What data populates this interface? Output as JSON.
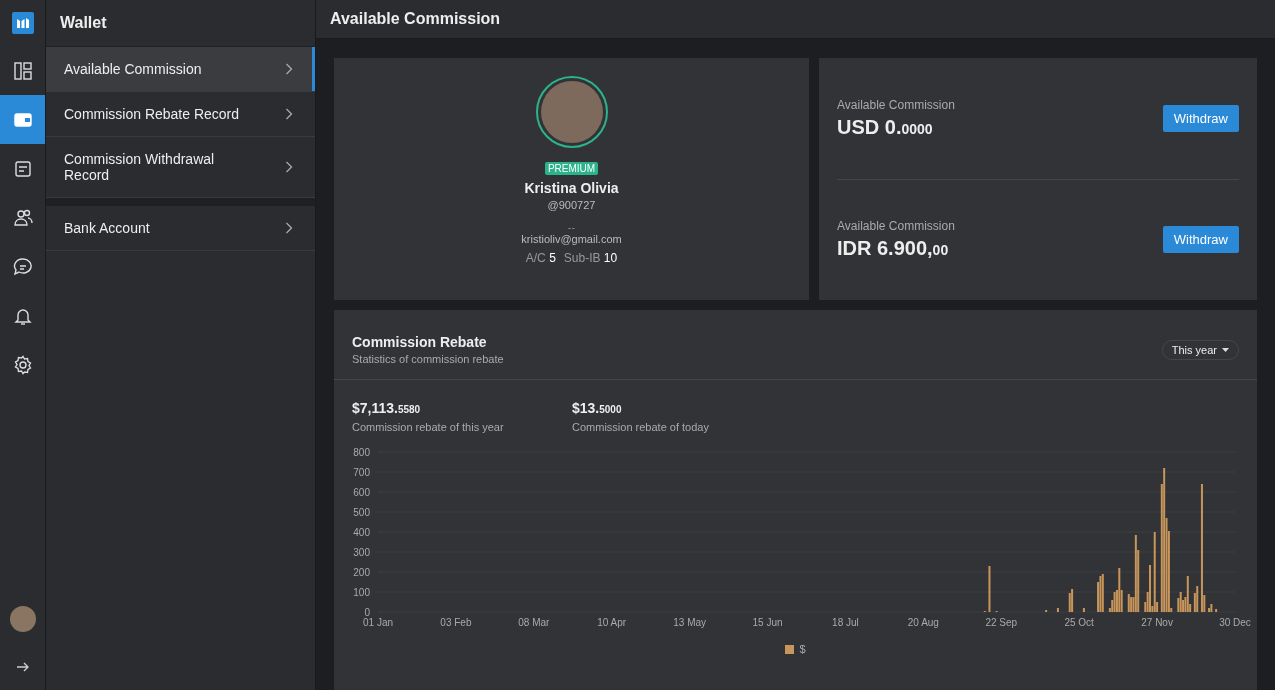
{
  "rail": [
    {
      "kind": "dashboard",
      "selected": false
    },
    {
      "kind": "wallet",
      "selected": true
    },
    {
      "kind": "document",
      "selected": false
    },
    {
      "kind": "users",
      "selected": false
    },
    {
      "kind": "chat",
      "selected": false
    },
    {
      "kind": "bell",
      "selected": false
    },
    {
      "kind": "settings",
      "selected": false
    }
  ],
  "sidebar": {
    "title": "Wallet",
    "groups": [
      {
        "items": [
          {
            "label": "Available Commission",
            "selected": true
          },
          {
            "label": "Commission Rebate Record",
            "selected": false
          },
          {
            "label": "Commission Withdrawal Record",
            "selected": false
          }
        ]
      },
      {
        "items": [
          {
            "label": "Bank Account",
            "selected": false
          }
        ]
      }
    ]
  },
  "page_title": "Available Commission",
  "profile": {
    "badge": "PREMIUM",
    "name": "Kristina Olivia",
    "handle": "@900727",
    "phone": "--",
    "email": "kristioliv@gmail.com",
    "stats": [
      {
        "label": "A/C",
        "value": "5"
      },
      {
        "label": "Sub-IB",
        "value": "10"
      }
    ]
  },
  "balances": [
    {
      "label": "Available Commission",
      "amount_main": "USD 0.",
      "amount_fraction": "0000",
      "button": "Withdraw"
    },
    {
      "label": "Available Commission",
      "amount_main": "IDR 6.900,",
      "amount_fraction": "00",
      "button": "Withdraw"
    }
  ],
  "rebate": {
    "title": "Commission Rebate",
    "subtitle": "Statistics of commission rebate",
    "period": "This year",
    "totals": [
      {
        "main": "$7,113.",
        "fraction": "5580",
        "label": "Commission rebate of this year"
      },
      {
        "main": "$13.",
        "fraction": "5000",
        "label": "Commission rebate of today"
      }
    ],
    "chart_data": {
      "type": "bar",
      "ylim": [
        0,
        800
      ],
      "yticks": [
        0,
        100,
        200,
        300,
        400,
        500,
        600,
        700,
        800
      ],
      "categories": [
        "01 Jan",
        null,
        null,
        null,
        null,
        null,
        null,
        null,
        null,
        null,
        null,
        null,
        null,
        null,
        null,
        null,
        null,
        null,
        null,
        null,
        null,
        null,
        null,
        null,
        null,
        null,
        null,
        null,
        null,
        null,
        null,
        null,
        null,
        "03 Feb",
        null,
        null,
        null,
        null,
        null,
        null,
        null,
        null,
        null,
        null,
        null,
        null,
        null,
        null,
        null,
        null,
        null,
        null,
        null,
        null,
        null,
        null,
        null,
        null,
        null,
        null,
        null,
        null,
        null,
        null,
        null,
        null,
        "08 Mar",
        null,
        null,
        null,
        null,
        null,
        null,
        null,
        null,
        null,
        null,
        null,
        null,
        null,
        null,
        null,
        null,
        null,
        null,
        null,
        null,
        null,
        null,
        null,
        null,
        null,
        null,
        null,
        null,
        null,
        null,
        null,
        null,
        "10 Apr",
        null,
        null,
        null,
        null,
        null,
        null,
        null,
        null,
        null,
        null,
        null,
        null,
        null,
        null,
        null,
        null,
        null,
        null,
        null,
        null,
        null,
        null,
        null,
        null,
        null,
        null,
        null,
        null,
        null,
        null,
        null,
        null,
        "13 May",
        null,
        null,
        null,
        null,
        null,
        null,
        null,
        null,
        null,
        null,
        null,
        null,
        null,
        null,
        null,
        null,
        null,
        null,
        null,
        null,
        null,
        null,
        null,
        null,
        null,
        null,
        null,
        null,
        null,
        null,
        null,
        null,
        "15 Jun",
        null,
        null,
        null,
        null,
        null,
        null,
        null,
        null,
        null,
        null,
        null,
        null,
        null,
        null,
        null,
        null,
        null,
        null,
        null,
        null,
        null,
        null,
        null,
        null,
        null,
        null,
        null,
        null,
        null,
        null,
        null,
        null,
        "18 Jul",
        null,
        null,
        null,
        null,
        null,
        null,
        null,
        null,
        null,
        null,
        null,
        null,
        null,
        null,
        null,
        null,
        null,
        null,
        null,
        null,
        null,
        null,
        null,
        null,
        null,
        null,
        null,
        null,
        null,
        null,
        null,
        null,
        "20 Aug",
        null,
        null,
        null,
        null,
        null,
        null,
        null,
        null,
        null,
        null,
        null,
        null,
        null,
        null,
        null,
        null,
        null,
        null,
        null,
        null,
        null,
        null,
        null,
        null,
        null,
        null,
        null,
        null,
        null,
        null,
        null,
        null,
        "22 Sep",
        null,
        null,
        null,
        null,
        null,
        null,
        null,
        null,
        null,
        null,
        null,
        null,
        null,
        null,
        null,
        null,
        null,
        null,
        null,
        null,
        null,
        null,
        null,
        null,
        null,
        null,
        null,
        null,
        null,
        null,
        null,
        null,
        "25 Oct",
        null,
        null,
        null,
        null,
        null,
        null,
        null,
        null,
        null,
        null,
        null,
        null,
        null,
        null,
        null,
        null,
        null,
        null,
        null,
        null,
        null,
        null,
        null,
        null,
        null,
        null,
        null,
        null,
        null,
        null,
        null,
        null,
        "27 Nov",
        null,
        null,
        null,
        null,
        null,
        null,
        null,
        null,
        null,
        null,
        null,
        null,
        null,
        null,
        null,
        null,
        null,
        null,
        null,
        null,
        null,
        null,
        null,
        null,
        null,
        null,
        null,
        null,
        null,
        null,
        null,
        null,
        "30 Dec"
      ],
      "series": [
        {
          "name": "$",
          "color": "#c8955a",
          "values": [
            0,
            0,
            0,
            0,
            0,
            0,
            0,
            0,
            0,
            0,
            0,
            0,
            0,
            0,
            0,
            0,
            0,
            0,
            0,
            0,
            0,
            0,
            0,
            0,
            0,
            0,
            0,
            0,
            0,
            0,
            0,
            0,
            0,
            0,
            0,
            0,
            0,
            0,
            0,
            0,
            0,
            0,
            0,
            0,
            0,
            0,
            0,
            0,
            0,
            0,
            0,
            0,
            0,
            0,
            0,
            0,
            0,
            0,
            0,
            0,
            0,
            0,
            0,
            0,
            0,
            0,
            0,
            0,
            0,
            0,
            0,
            0,
            0,
            0,
            0,
            0,
            0,
            0,
            0,
            0,
            0,
            0,
            0,
            0,
            0,
            0,
            0,
            0,
            0,
            0,
            0,
            0,
            0,
            0,
            0,
            0,
            0,
            0,
            0,
            0,
            0,
            0,
            0,
            0,
            0,
            0,
            0,
            0,
            0,
            0,
            0,
            0,
            0,
            0,
            0,
            0,
            0,
            0,
            0,
            0,
            0,
            0,
            0,
            0,
            0,
            0,
            0,
            0,
            0,
            0,
            0,
            0,
            0,
            0,
            0,
            0,
            0,
            0,
            0,
            0,
            0,
            0,
            0,
            0,
            0,
            0,
            0,
            0,
            0,
            0,
            0,
            0,
            0,
            0,
            0,
            0,
            0,
            0,
            0,
            0,
            0,
            0,
            0,
            0,
            0,
            0,
            0,
            0,
            0,
            0,
            0,
            0,
            0,
            0,
            0,
            0,
            0,
            0,
            0,
            0,
            0,
            0,
            0,
            0,
            0,
            0,
            0,
            0,
            0,
            0,
            0,
            0,
            0,
            0,
            0,
            0,
            0,
            0,
            0,
            0,
            0,
            0,
            0,
            0,
            0,
            0,
            0,
            0,
            0,
            0,
            0,
            0,
            0,
            0,
            0,
            0,
            0,
            0,
            0,
            0,
            0,
            0,
            0,
            0,
            0,
            0,
            0,
            0,
            0,
            0,
            0,
            0,
            0,
            0,
            0,
            0,
            0,
            0,
            0,
            0,
            0,
            0,
            0,
            0,
            0,
            0,
            0,
            0,
            0,
            0,
            0,
            0,
            0,
            0,
            0,
            0,
            0,
            5,
            0,
            230,
            0,
            0,
            5,
            0,
            0,
            0,
            0,
            0,
            0,
            0,
            0,
            0,
            0,
            0,
            0,
            0,
            0,
            0,
            0,
            0,
            0,
            0,
            0,
            10,
            0,
            0,
            0,
            0,
            20,
            0,
            0,
            0,
            0,
            95,
            115,
            0,
            0,
            0,
            0,
            20,
            0,
            0,
            0,
            0,
            0,
            150,
            180,
            190,
            0,
            0,
            20,
            60,
            100,
            110,
            220,
            110,
            0,
            0,
            90,
            75,
            75,
            385,
            310,
            0,
            0,
            50,
            100,
            235,
            30,
            400,
            50,
            0,
            640,
            720,
            470,
            405,
            20,
            0,
            0,
            70,
            100,
            60,
            75,
            180,
            40,
            0,
            95,
            130,
            0,
            640,
            85,
            0,
            20,
            40,
            0,
            15,
            0,
            0,
            0,
            0,
            0,
            0,
            0,
            0
          ]
        }
      ]
    }
  }
}
